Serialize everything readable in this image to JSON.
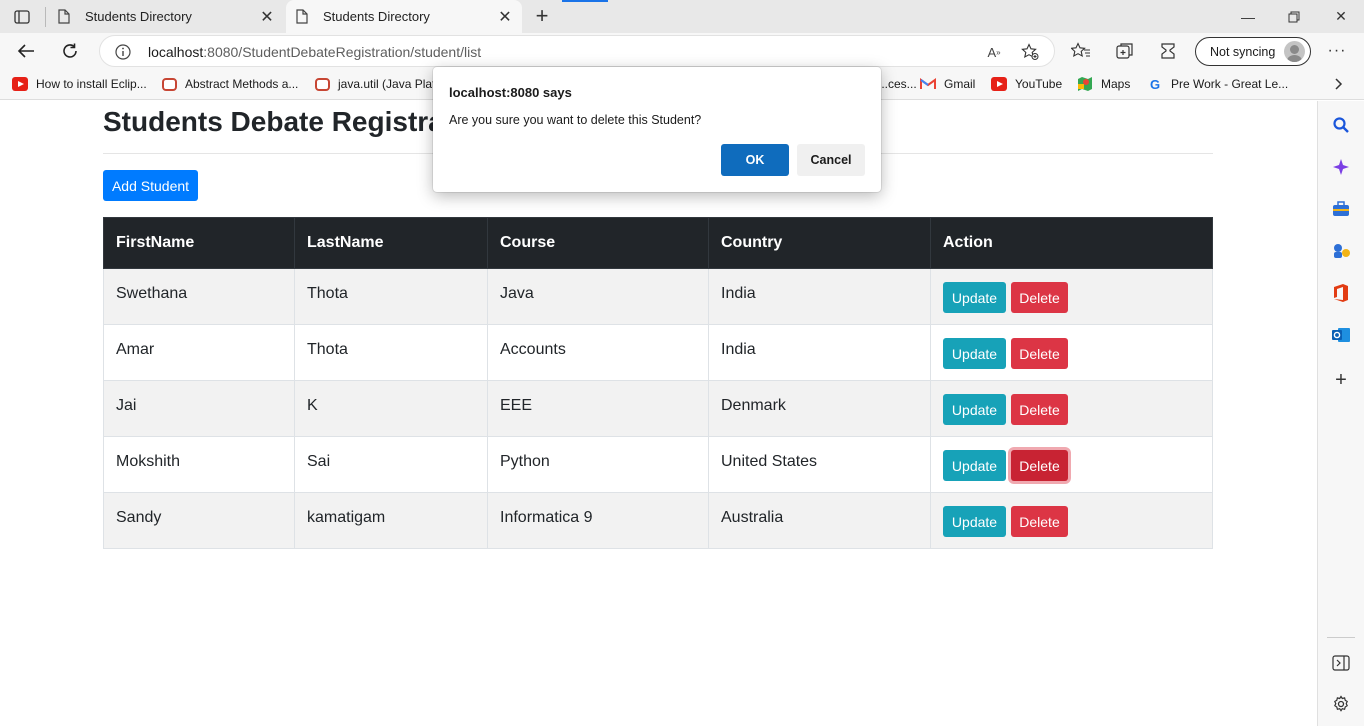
{
  "browser": {
    "tabs": [
      {
        "title": "Students Directory",
        "active": false
      },
      {
        "title": "Students Directory",
        "active": true
      }
    ],
    "url_host": "localhost",
    "url_rest": ":8080/StudentDebateRegistration/student/list",
    "sync_label": "Not syncing",
    "bookmarks": [
      {
        "label": "How to install Eclip...",
        "icon": "youtube-icon"
      },
      {
        "label": "Abstract Methods a...",
        "icon": "oracle-icon"
      },
      {
        "label": "java.util (Java Platf",
        "icon": "oracle-icon"
      },
      {
        "label": "...ces...",
        "icon": "generic"
      },
      {
        "label": "Gmail",
        "icon": "gmail-icon"
      },
      {
        "label": "YouTube",
        "icon": "youtube-icon"
      },
      {
        "label": "Maps",
        "icon": "maps-icon"
      },
      {
        "label": "Pre Work - Great Le...",
        "icon": "great-learning-icon"
      }
    ]
  },
  "page": {
    "title": "Students Debate Registration",
    "add_button": "Add Student",
    "table": {
      "headers": [
        "FirstName",
        "LastName",
        "Course",
        "Country",
        "Action"
      ],
      "rows": [
        {
          "first": "Swethana",
          "last": "Thota",
          "course": "Java",
          "country": "India"
        },
        {
          "first": "Amar",
          "last": "Thota",
          "course": "Accounts",
          "country": "India"
        },
        {
          "first": "Jai",
          "last": "K",
          "course": "EEE",
          "country": "Denmark"
        },
        {
          "first": "Mokshith",
          "last": "Sai",
          "course": "Python",
          "country": "United States"
        },
        {
          "first": "Sandy",
          "last": "kamatigam",
          "course": "Informatica 9",
          "country": "Australia"
        }
      ],
      "update_label": "Update",
      "delete_label": "Delete"
    }
  },
  "dialog": {
    "title": "localhost:8080 says",
    "message": "Are you sure you want to delete this Student?",
    "ok": "OK",
    "cancel": "Cancel"
  },
  "colors": {
    "primary": "#007bff",
    "info": "#17a2b8",
    "danger": "#dc3545",
    "table_header": "#212529",
    "dialog_ok": "#0f6cbd"
  }
}
